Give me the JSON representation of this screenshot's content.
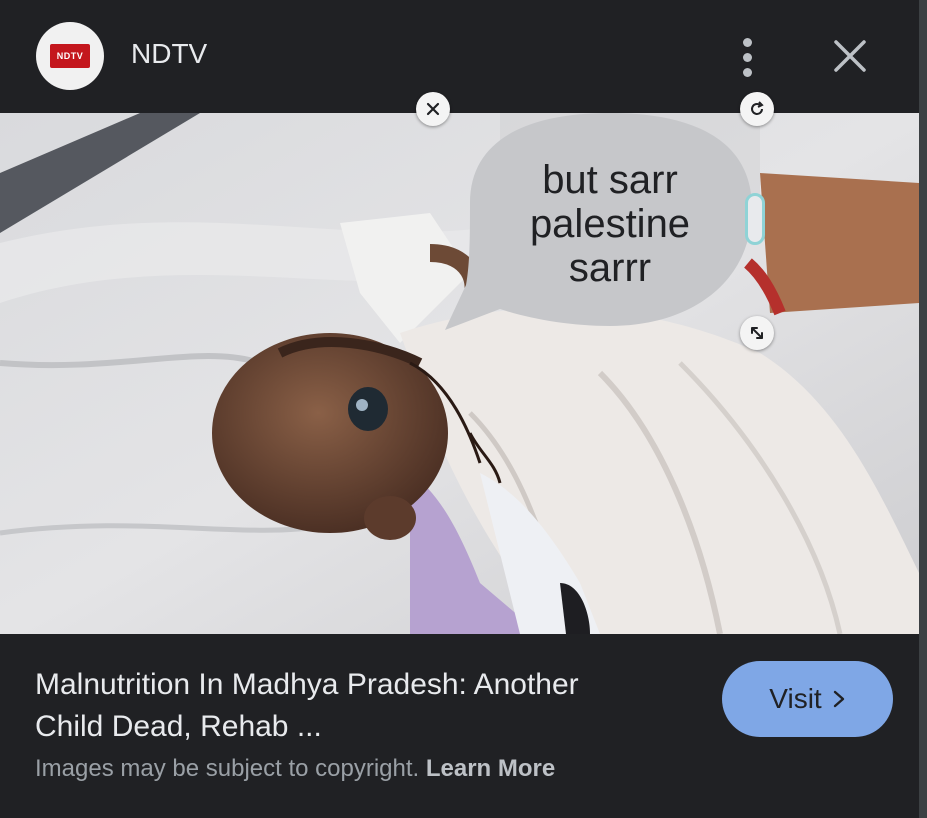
{
  "header": {
    "logo_text": "NDTV",
    "source_name": "NDTV",
    "menu_icon": "more-vert-icon",
    "close_icon": "close-icon"
  },
  "image": {
    "alt": "photo",
    "sticker": {
      "lines": [
        "but sarr",
        "palestine",
        "sarrr"
      ],
      "delete_icon": "close-icon",
      "rotate_icon": "rotate-icon",
      "resize_icon": "resize-icon"
    }
  },
  "result": {
    "headline_line1": "Malnutrition In Madhya Pradesh: Another",
    "headline_line2": "Child Dead, Rehab ...",
    "copyright_text": "Images may be subject to copyright.",
    "learn_more": "Learn More",
    "visit_label": "Visit",
    "visit_icon": "chevron-right-icon"
  },
  "colors": {
    "background": "#202124",
    "accent": "#7fa7e6",
    "logo_red": "#c4171d"
  }
}
